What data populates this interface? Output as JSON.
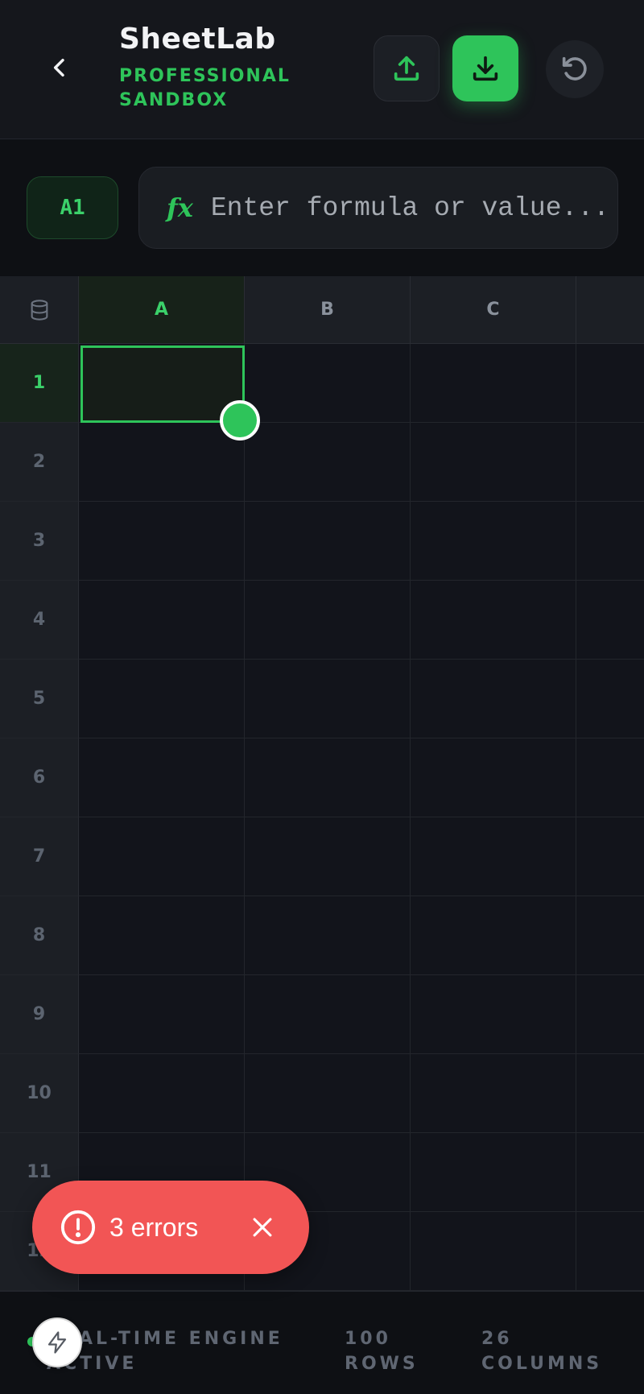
{
  "app": {
    "title": "SheetLab",
    "subtitle": "PROFESSIONAL SANDBOX",
    "accent_color": "#2ec45a"
  },
  "header": {
    "back_icon": "chevron-left-icon",
    "upload_icon": "upload-icon",
    "download_icon": "download-icon",
    "reset_icon": "rotate-ccw-icon"
  },
  "formula_bar": {
    "cell_ref": "A1",
    "fx_label": "fx",
    "placeholder": "Enter formula or value...",
    "value": ""
  },
  "grid": {
    "corner_icon": "database-icon",
    "columns": [
      "A",
      "B",
      "C"
    ],
    "rows": [
      "1",
      "2",
      "3",
      "4",
      "5",
      "6",
      "7",
      "8",
      "9",
      "10",
      "11",
      "12"
    ],
    "selected_cell": "A1"
  },
  "footer": {
    "engine_status": "REAL-TIME ENGINE ACTIVE",
    "rows": "100 ROWS",
    "columns": "26 COLUMNS"
  },
  "toast": {
    "message": "3 errors",
    "color": "#f25555",
    "icon": "alert-circle-icon"
  }
}
